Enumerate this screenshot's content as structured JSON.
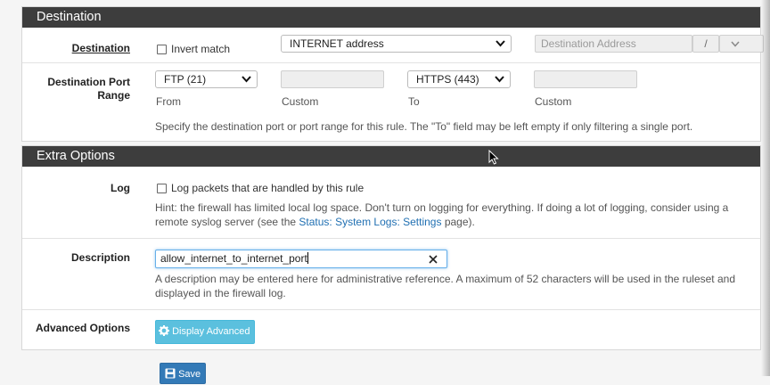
{
  "destination": {
    "header": "Destination",
    "label": "Destination",
    "invert_label": "Invert match",
    "type_value": "INTERNET address",
    "address_placeholder": "Destination Address",
    "slash": "/"
  },
  "port_range": {
    "label_line1": "Destination Port",
    "label_line2": "Range",
    "from_value": "FTP (21)",
    "from_label": "From",
    "custom_label_1": "Custom",
    "to_value": "HTTPS (443)",
    "to_label": "To",
    "custom_label_2": "Custom",
    "help": "Specify the destination port or port range for this rule. The \"To\" field may be left empty if only filtering a single port."
  },
  "extra": {
    "header": "Extra Options",
    "log_label": "Log",
    "log_checkbox_label": "Log packets that are handled by this rule",
    "log_hint_1": "Hint: the firewall has limited local log space. Don't turn on logging for everything. If doing a lot of logging, consider using a",
    "log_hint_2a": "remote syslog server (see the ",
    "log_hint_link": "Status: System Logs: Settings",
    "log_hint_2b": " page).",
    "description_label": "Description",
    "description_value": "allow_internet_to_internet_port",
    "description_help_1": "A description may be entered here for administrative reference. A maximum of 52 characters will be used in the ruleset and",
    "description_help_2": "displayed in the firewall log.",
    "advanced_label": "Advanced Options",
    "advanced_button": "Display Advanced"
  },
  "save_button": "Save"
}
